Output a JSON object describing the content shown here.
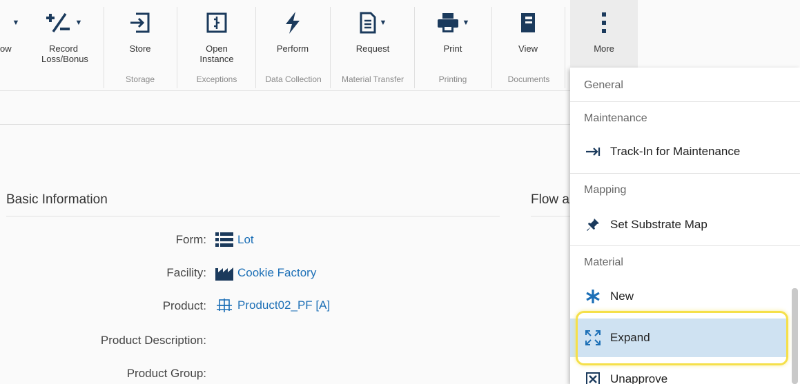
{
  "ribbon": {
    "tools": [
      {
        "label": "ow",
        "icon": "arrow-down-icon"
      },
      {
        "label": "Record Loss/Bonus",
        "icon": "plus-minus-icon"
      },
      {
        "label": "Store",
        "icon": "store-icon"
      },
      {
        "label": "Open Instance",
        "icon": "open-instance-icon"
      },
      {
        "label": "Perform",
        "icon": "lightning-icon"
      },
      {
        "label": "Request",
        "icon": "document-icon"
      },
      {
        "label": "Print",
        "icon": "printer-icon"
      },
      {
        "label": "View",
        "icon": "book-icon"
      },
      {
        "label": "More",
        "icon": "vertical-ellipsis-icon"
      }
    ],
    "groups": [
      "Storage",
      "Exceptions",
      "Data Collection",
      "Material Transfer",
      "Printing",
      "Documents"
    ]
  },
  "main": {
    "section_title": "Basic Information",
    "right_section_title": "Flow a",
    "fields": [
      {
        "label": "Form:",
        "value": "Lot",
        "icon": "list-icon"
      },
      {
        "label": "Facility:",
        "value": "Cookie Factory",
        "icon": "factory-icon"
      },
      {
        "label": "Product:",
        "value": "Product02_PF [A]",
        "icon": "product-icon"
      },
      {
        "label": "Product Description:",
        "value": ""
      },
      {
        "label": "Product Group:",
        "value": ""
      }
    ]
  },
  "menu": {
    "headers": [
      "General",
      "Maintenance",
      "Mapping",
      "Material"
    ],
    "items": [
      {
        "label": "Track-In for Maintenance",
        "icon": "track-in-icon"
      },
      {
        "label": "Set Substrate Map",
        "icon": "pin-icon"
      },
      {
        "label": "New",
        "icon": "asterisk-icon"
      },
      {
        "label": "Expand",
        "icon": "expand-icon",
        "active": true
      },
      {
        "label": "Unapprove",
        "icon": "unapprove-icon"
      }
    ]
  },
  "colors": {
    "icon_navy": "#1b3a5c",
    "link_blue": "#1c6fb6",
    "active_item": "#cfe2f2",
    "highlight": "#f5e04a"
  }
}
